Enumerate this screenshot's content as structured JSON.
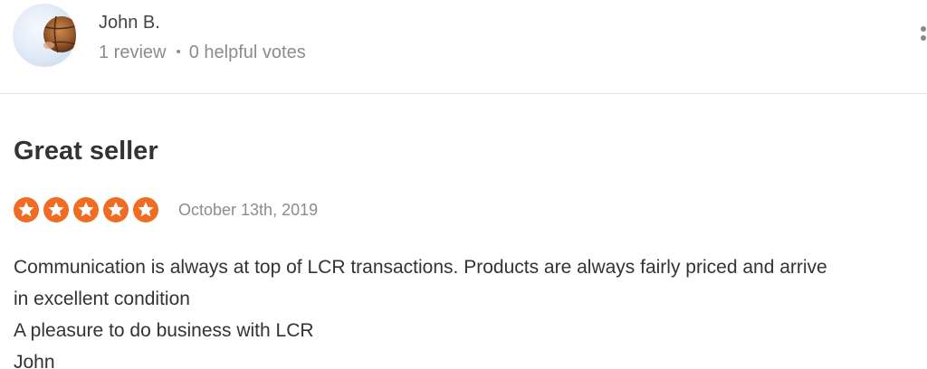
{
  "reviewer": {
    "name": "John B.",
    "review_count": "1 review",
    "separator": "•",
    "helpful_votes": "0 helpful votes"
  },
  "review": {
    "title": "Great seller",
    "rating": 5,
    "rating_max": 5,
    "date": "October 13th, 2019",
    "body_lines": [
      "Communication is always at top of LCR transactions. Products are always fairly priced and arrive",
      "in excellent condition",
      "A pleasure to do business with LCR",
      "John"
    ]
  },
  "icons": {
    "avatar": "avatar-photo",
    "menu": "more-vertical-icon",
    "star": "star-icon"
  },
  "colors": {
    "star_fill": "#f26b22",
    "name_text": "#444444",
    "meta_text": "#8c8c8c",
    "body_text": "#333333",
    "divider": "#e3e3e3",
    "menu_dots": "#8a8a8a"
  }
}
